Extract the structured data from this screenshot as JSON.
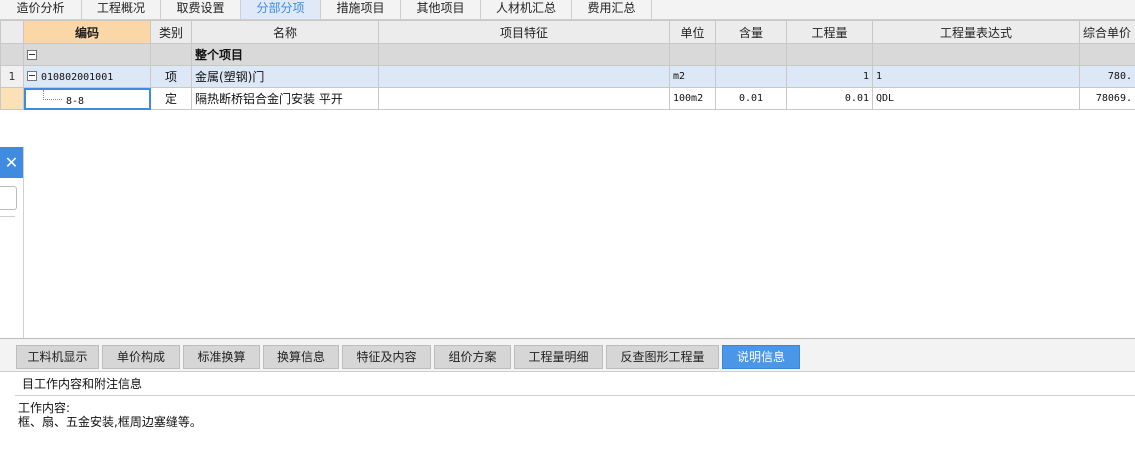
{
  "top_tabs": [
    {
      "label": "造价分析",
      "active": false
    },
    {
      "label": "工程概况",
      "active": false
    },
    {
      "label": "取费设置",
      "active": false
    },
    {
      "label": "分部分项",
      "active": true
    },
    {
      "label": "措施项目",
      "active": false
    },
    {
      "label": "其他项目",
      "active": false
    },
    {
      "label": "人材机汇总",
      "active": false
    },
    {
      "label": "费用汇总",
      "active": false
    }
  ],
  "grid": {
    "columns": [
      "编码",
      "类别",
      "名称",
      "项目特征",
      "单位",
      "含量",
      "工程量",
      "工程量表达式",
      "综合单价"
    ],
    "whole_row": {
      "label": "整个项目"
    },
    "item_row": {
      "rownum": "1",
      "code": "010802001001",
      "category": "项",
      "name": "金属(塑钢)门",
      "feature": "",
      "unit": "m2",
      "content": "",
      "quantity": "1",
      "expression": "1",
      "unit_price": "780."
    },
    "quota_row": {
      "code": "8-8",
      "category": "定",
      "name": "隔热断桥铝合金门安装 平开",
      "feature": "",
      "unit": "100m2",
      "content": "0.01",
      "quantity": "0.01",
      "expression": "QDL",
      "unit_price": "78069."
    }
  },
  "side_panel": {
    "close_symbol": "✕"
  },
  "bottom_tabs": [
    {
      "label": "工料机显示",
      "active": false
    },
    {
      "label": "单价构成",
      "active": false
    },
    {
      "label": "标准换算",
      "active": false
    },
    {
      "label": "换算信息",
      "active": false
    },
    {
      "label": "特征及内容",
      "active": false
    },
    {
      "label": "组价方案",
      "active": false
    },
    {
      "label": "工程量明细",
      "active": false
    },
    {
      "label": "反查图形工程量",
      "active": false
    },
    {
      "label": "说明信息",
      "active": true
    }
  ],
  "info": {
    "section_title": "目工作内容和附注信息",
    "line1": "工作内容:",
    "line2": "框、扇、五金安装,框周边塞缝等。"
  },
  "colors": {
    "accent": "#3e8be0",
    "selected_header": "#fbd7a7",
    "item_row": "#dde8f7",
    "whole_row": "#d9d9d9"
  }
}
